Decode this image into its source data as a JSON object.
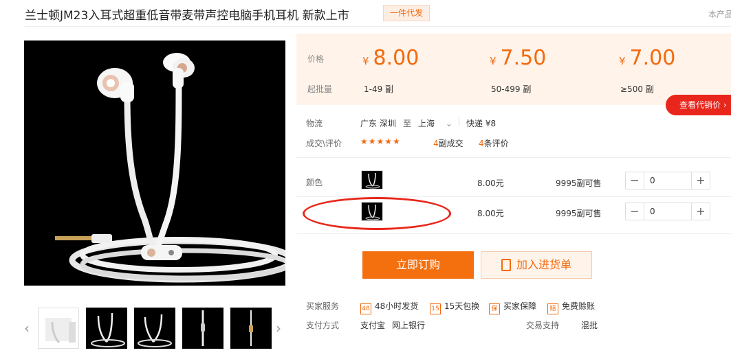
{
  "header": {
    "title": "兰士顿JM23入耳式超重低音带麦带声控电脑手机耳机 新款上市",
    "badge": "一件代发",
    "corner_text": "本产品"
  },
  "price_table": {
    "price_label": "价格",
    "batch_label": "起批量",
    "currency": "¥",
    "tiers": [
      {
        "price": "8.00",
        "range": "1-49 副"
      },
      {
        "price": "7.50",
        "range": "50-499 副"
      },
      {
        "price": "7.00",
        "range": "≥500 副"
      }
    ],
    "agent_button": "查看代销价"
  },
  "logistics": {
    "label": "物流",
    "from": "广东 深圳",
    "to_word": "至",
    "to": "上海",
    "shipping": "快递 ¥8"
  },
  "deals": {
    "label": "成交\\评价",
    "stars": "★★★★★",
    "deals_count": "4",
    "deals_text": "副成交",
    "reviews_count": "4",
    "reviews_text": "条评价"
  },
  "variants": {
    "label": "颜色",
    "items": [
      {
        "price": "8.00元",
        "stock": "9995副可售",
        "qty": "0"
      },
      {
        "price": "8.00元",
        "stock": "9995副可售",
        "qty": "0"
      }
    ]
  },
  "actions": {
    "order": "立即订购",
    "add_cart": "加入进货单"
  },
  "services": {
    "label": "买家服务",
    "items": [
      {
        "icon": "48",
        "text": "48小时发货"
      },
      {
        "icon": "15",
        "text": "15天包换"
      },
      {
        "icon": "保",
        "text": "买家保障"
      },
      {
        "icon": "赔",
        "text": "免费赊账"
      }
    ]
  },
  "payment": {
    "label": "支付方式",
    "methods": [
      "支付宝",
      "网上银行"
    ],
    "trade_label": "交易支持",
    "trade_value": "混批"
  },
  "colors": {
    "accent": "#f26a0e",
    "red": "#e9261c",
    "price_bg": "#fff3ea"
  }
}
